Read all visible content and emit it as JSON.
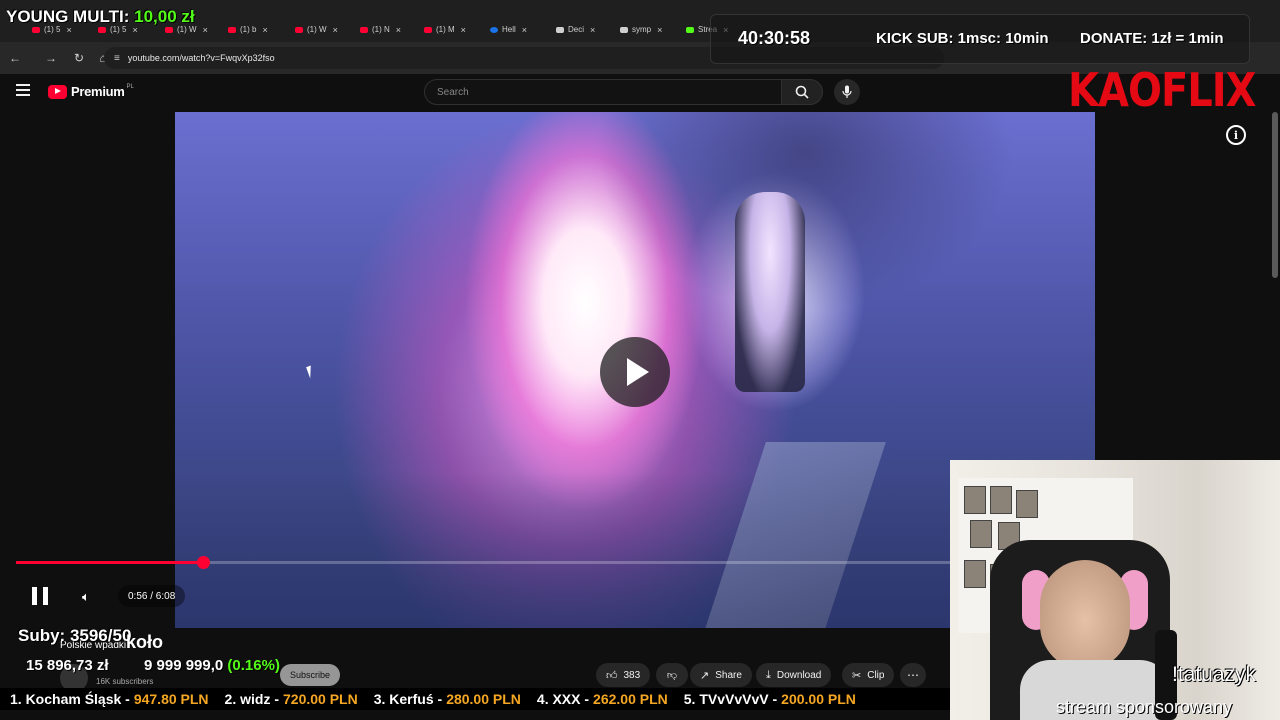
{
  "browser": {
    "tabs": [
      {
        "label": "(1) 5",
        "kind": "yt"
      },
      {
        "label": "(1) 5",
        "kind": "yt"
      },
      {
        "label": "(1) W",
        "kind": "yt"
      },
      {
        "label": "(1) b",
        "kind": "yt"
      },
      {
        "label": "(1) W",
        "kind": "yt"
      },
      {
        "label": "(1) N",
        "kind": "yt"
      },
      {
        "label": "(1) M",
        "kind": "yt"
      },
      {
        "label": "Hell",
        "kind": "g"
      },
      {
        "label": "Deci",
        "kind": "d"
      },
      {
        "label": "symp",
        "kind": "d"
      },
      {
        "label": "Strea",
        "kind": "k"
      }
    ],
    "url": "youtube.com/watch?v=FwqvXp32fso"
  },
  "youtube": {
    "logo_text": "Premium",
    "country_code": "PL",
    "search_placeholder": "Search"
  },
  "player": {
    "progress_fraction": 0.2,
    "current_time": "0:56",
    "duration": "6:08",
    "timecode": "0:56 / 6:08",
    "state": "paused"
  },
  "actions": {
    "like_count": "383",
    "share_label": "Share",
    "download_label": "Download",
    "clip_label": "Clip",
    "subscribe_label": "Subscribe",
    "subscribers": "16K subscribers"
  },
  "overlay": {
    "young_multi_label": "YOUNG MULTI:",
    "young_multi_amount": "10,00 zł",
    "timer": "40:30:58",
    "kick_sub": "KICK SUB: 1msc: 10min",
    "donate": "DONATE: 1zł = 1min",
    "brand": "KAOFLIX",
    "suby": "Suby: 3596/50",
    "channel_partial": "Polskie wpadki",
    "kolo": "koło",
    "money_raised": "15 896,73 zł",
    "goal": "9 999 999,0",
    "goal_pct": "(0.16%)",
    "webcam_name": "!tatuazyk",
    "sponsored": "stream sponsorowany",
    "ticker": [
      {
        "rank": "1. Kocham Śląsk -",
        "amount": "947.80 PLN"
      },
      {
        "rank": "2. widz -",
        "amount": "720.00 PLN"
      },
      {
        "rank": "3. Kerfuś -",
        "amount": "280.00 PLN"
      },
      {
        "rank": "4. XXX -",
        "amount": "262.00 PLN"
      },
      {
        "rank": "5. TVvVvVvV -",
        "amount": "200.00 PLN"
      }
    ]
  },
  "colors": {
    "yt_red": "#ff0033",
    "kick_green": "#53fc18",
    "kaoflix_red": "#e50914",
    "ticker_amount": "#f5a623"
  }
}
